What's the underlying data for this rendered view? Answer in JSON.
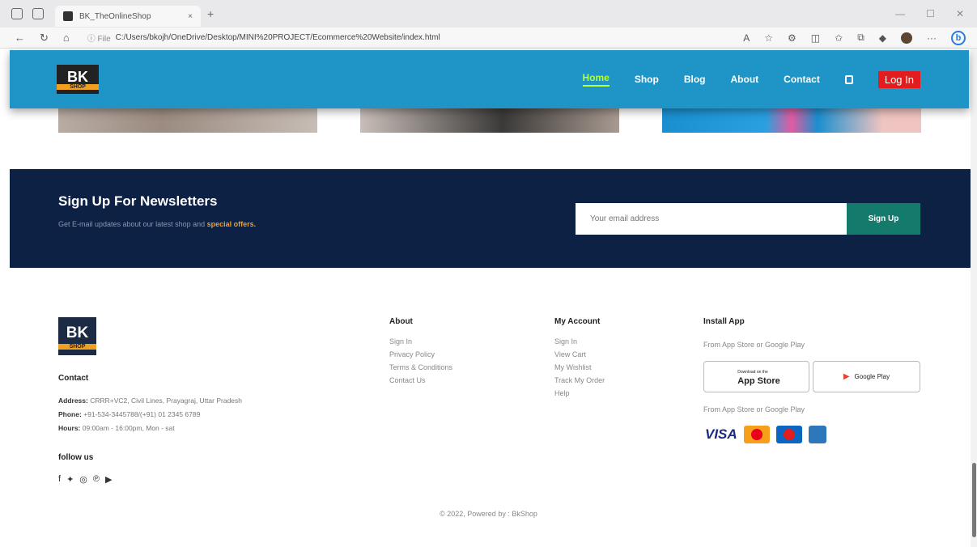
{
  "browser": {
    "tab_title": "BK_TheOnlineShop",
    "tab_close": "×",
    "new_tab": "+",
    "url_prefix": "ⓘ File",
    "url": "C:/Users/bkojh/OneDrive/Desktop/MINI%20PROJECT/Ecommerce%20Website/index.html",
    "bing": "b"
  },
  "header": {
    "logo_top": "BK",
    "logo_bottom": "SHOP",
    "nav": [
      "Home",
      "Shop",
      "Blog",
      "About",
      "Contact"
    ],
    "login": "Log In"
  },
  "newsletter": {
    "title": "Sign Up For Newsletters",
    "subtitle": "Get E-mail updates about our latest shop and",
    "highlight": "special offers.",
    "placeholder": "Your email address",
    "button": "Sign Up"
  },
  "footer": {
    "logo_top": "BK",
    "logo_bottom": "SHOP",
    "contact_heading": "Contact",
    "address_label": "Address:",
    "address": "CRRR+VC2, Civil Lines, Prayagraj, Uttar Pradesh",
    "phone_label": "Phone:",
    "phone": "+91-534-3445788/(+91) 01 2345 6789",
    "hours_label": "Hours:",
    "hours": "09:00am - 16:00pm, Mon - sat",
    "follow": "follow us",
    "about_heading": "About",
    "about_links": [
      "Sign In",
      "Privacy Policy",
      "Terms & Conditions",
      "Contact Us"
    ],
    "account_heading": "My Account",
    "account_links": [
      "Sign In",
      "View Cart",
      "My Wishlist",
      "Track My Order",
      "Help"
    ],
    "install_heading": "Install App",
    "install_text1": "From App Store or Google Play",
    "appstore_small": "Download on the",
    "appstore": "App Store",
    "googleplay": "Google Play",
    "install_text2": "From App Store or Google Play",
    "visa": "VISA",
    "copyright": "© 2022, Powered by : BkShop"
  }
}
